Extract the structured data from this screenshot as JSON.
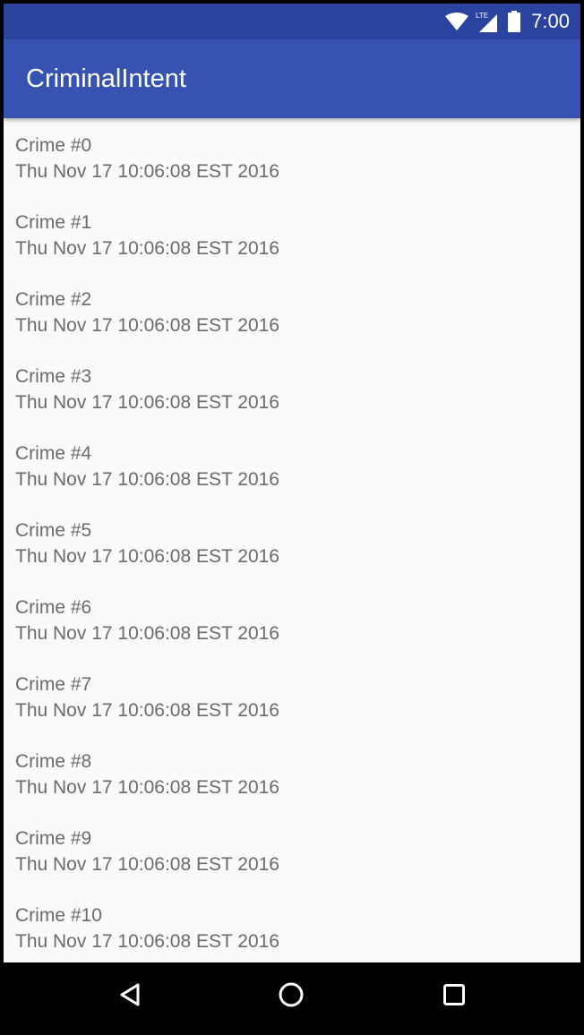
{
  "status_bar": {
    "time": "7:00",
    "network_label": "LTE",
    "icons": [
      "wifi-icon",
      "lte-signal-icon",
      "battery-icon"
    ],
    "color": "#2a439f"
  },
  "app_bar": {
    "title": "CriminalIntent",
    "color": "#3653b2"
  },
  "crimes": [
    {
      "title": "Crime #0",
      "date": "Thu Nov 17 10:06:08 EST 2016"
    },
    {
      "title": "Crime #1",
      "date": "Thu Nov 17 10:06:08 EST 2016"
    },
    {
      "title": "Crime #2",
      "date": "Thu Nov 17 10:06:08 EST 2016"
    },
    {
      "title": "Crime #3",
      "date": "Thu Nov 17 10:06:08 EST 2016"
    },
    {
      "title": "Crime #4",
      "date": "Thu Nov 17 10:06:08 EST 2016"
    },
    {
      "title": "Crime #5",
      "date": "Thu Nov 17 10:06:08 EST 2016"
    },
    {
      "title": "Crime #6",
      "date": "Thu Nov 17 10:06:08 EST 2016"
    },
    {
      "title": "Crime #7",
      "date": "Thu Nov 17 10:06:08 EST 2016"
    },
    {
      "title": "Crime #8",
      "date": "Thu Nov 17 10:06:08 EST 2016"
    },
    {
      "title": "Crime #9",
      "date": "Thu Nov 17 10:06:08 EST 2016"
    },
    {
      "title": "Crime #10",
      "date": "Thu Nov 17 10:06:08 EST 2016"
    }
  ],
  "nav_bar": {
    "buttons": [
      "back-icon",
      "home-icon",
      "recents-icon"
    ]
  }
}
